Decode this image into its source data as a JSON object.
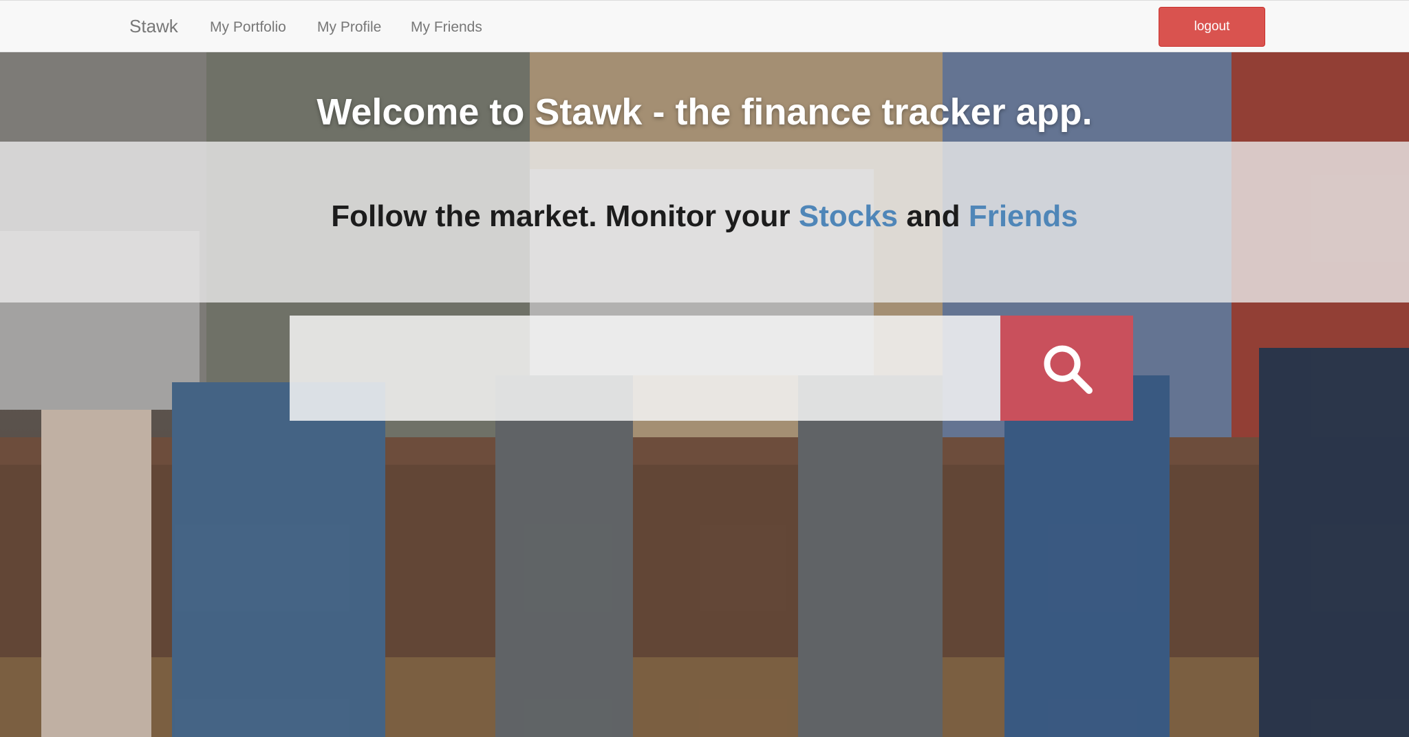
{
  "navbar": {
    "brand": "Stawk",
    "links": [
      "My Portfolio",
      "My Profile",
      "My Friends"
    ],
    "logout_label": "logout"
  },
  "hero": {
    "welcome": "Welcome to Stawk - the finance tracker app.",
    "tagline_prefix": "Follow the market. Monitor your ",
    "tagline_stocks": "Stocks",
    "tagline_and": " and ",
    "tagline_friends": "Friends"
  },
  "search": {
    "value": "",
    "placeholder": "",
    "button_icon": "search-icon"
  },
  "colors": {
    "logout": "#d9534f",
    "search_button": "#c9505c",
    "accent_link": "#4f86b8"
  }
}
